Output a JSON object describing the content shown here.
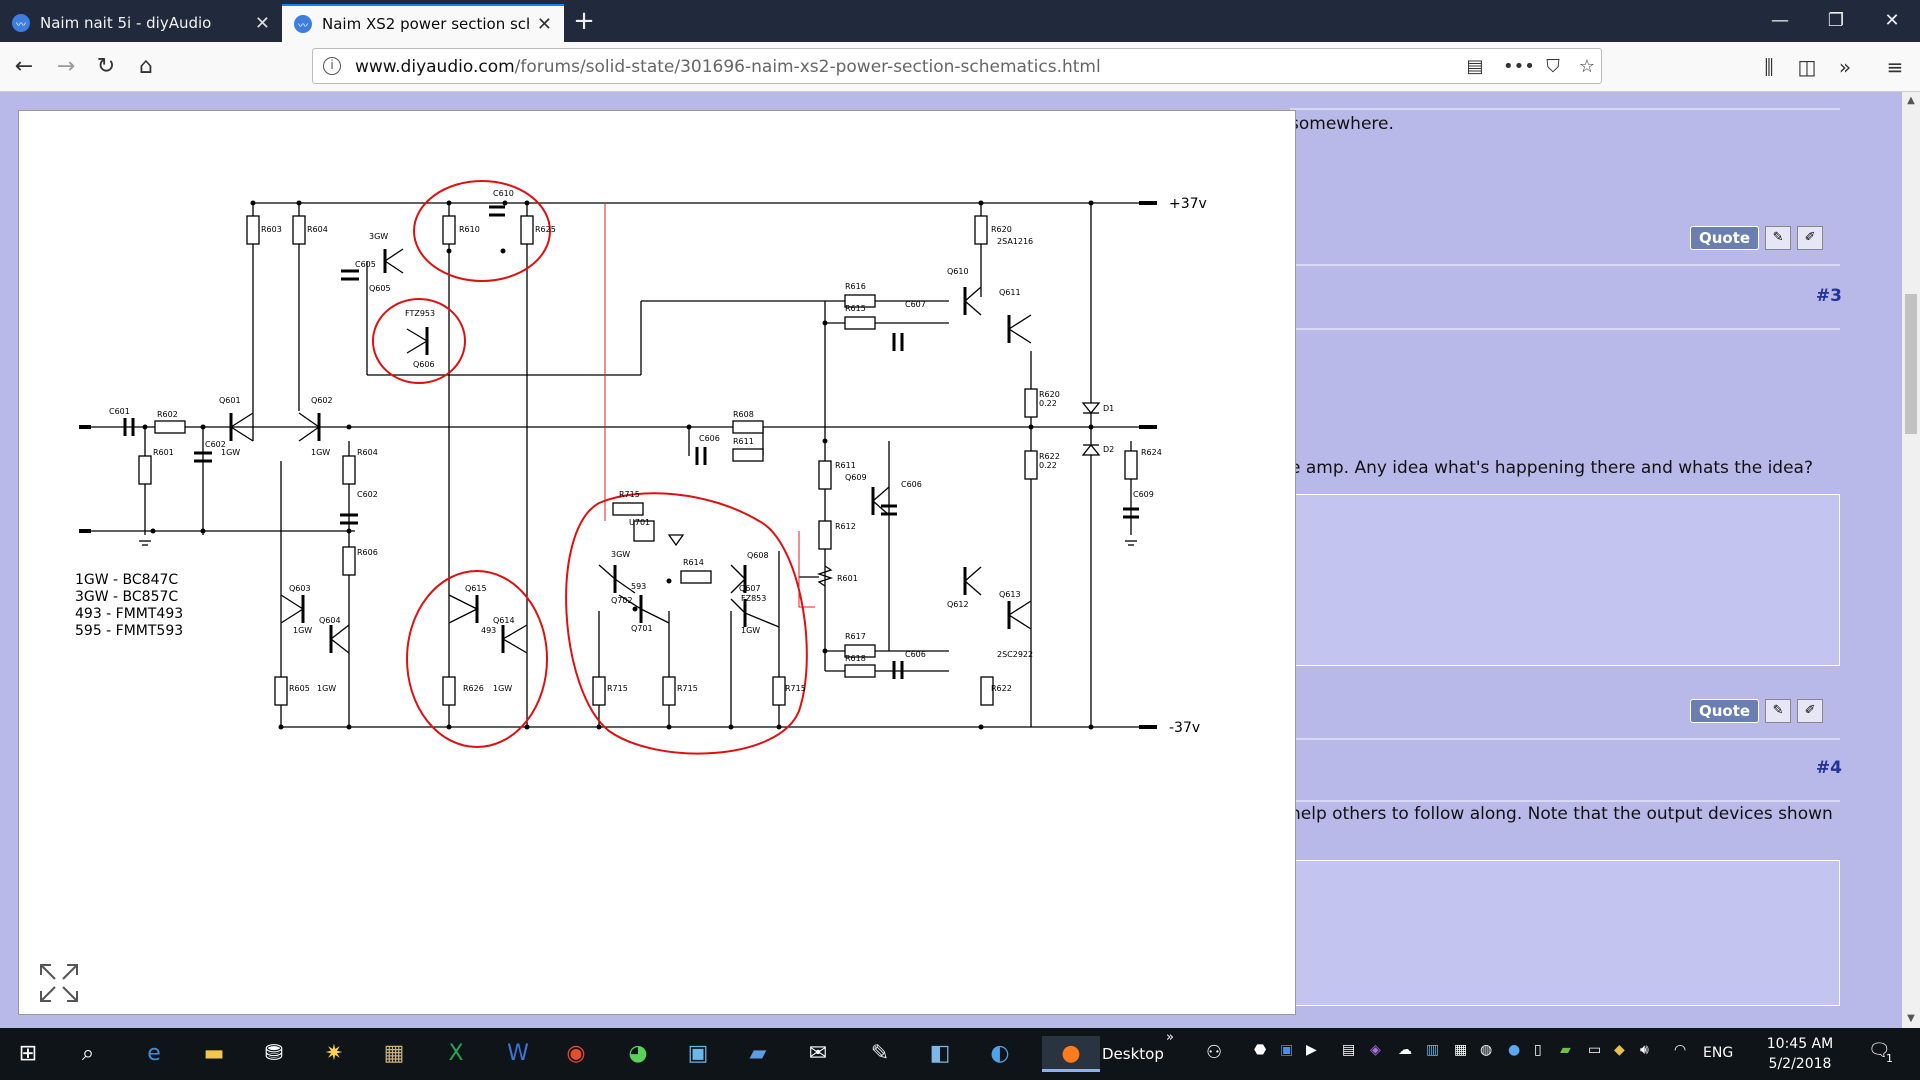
{
  "browser": {
    "tabs": [
      {
        "title": "Naim nait 5i - diyAudio",
        "active": false
      },
      {
        "title": "Naim XS2 power section schem",
        "active": true
      }
    ],
    "url_host": "www.diyaudio.com",
    "url_path": "/forums/solid-state/301696-naim-xs2-power-section-schematics.html"
  },
  "page": {
    "fragment_top": "somewhere.",
    "quote_label": "Quote",
    "post3_number": "#3",
    "post3_text": "e amp. Any idea what's happening there and whats the idea?",
    "post4_number": "#4",
    "post4_text": "help others to follow along. Note that the output devices shown"
  },
  "schematic": {
    "rail_pos": "+37v",
    "rail_neg": "-37v",
    "legend": [
      "1GW - BC847C",
      "3GW - BC857C",
      "493 - FMMT493",
      "595 - FMMT593"
    ],
    "labels": {
      "R603": "R603",
      "R604a": "R604",
      "R610": "R610",
      "C610": "C610",
      "R625": "R625",
      "g3GWa": "3GW",
      "C605": "C605",
      "Q605": "Q605",
      "FTZ953": "FTZ953",
      "Q606": "Q606",
      "R620": "R620",
      "SA1216": "2SA1216",
      "Q610": "Q610",
      "Q611": "Q611",
      "R616": "R616",
      "R615": "R615",
      "C607": "C607",
      "C601": "C601",
      "R602": "R602",
      "Q601": "Q601",
      "Q602": "Q602",
      "C602a": "C602",
      "g1GWa": "1GW",
      "g1GWb": "1GW",
      "R601a": "R601",
      "R604b": "R604",
      "R608": "R608",
      "C606a": "C606",
      "R611a": "R611",
      "R620b": "R620",
      "v022a": "0.22",
      "D1": "D1",
      "D2": "D2",
      "R622a": "R622",
      "v022b": "0.22",
      "R624": "R624",
      "R611b": "R611",
      "Q609": "Q609",
      "C606b": "C606",
      "C609": "C609",
      "C602b": "C602",
      "R715a": "R715",
      "U701": "U701",
      "R612": "R612",
      "R606": "R606",
      "g3GWb": "3GW",
      "R614": "R614",
      "Q608": "Q608",
      "R601b": "R601",
      "Q603": "Q603",
      "Q615": "Q615",
      "v593": "593",
      "Q702": "Q702",
      "Q607": "Q607",
      "FZ853": "FZ853",
      "Q613": "Q613",
      "Q612": "Q612",
      "Q604": "Q604",
      "Q614": "Q614",
      "v493": "493",
      "Q701": "Q701",
      "g1GWc": "1GW",
      "R617": "R617",
      "R618": "R618",
      "C606c": "C606",
      "SC2922": "2SC2922",
      "g1GWd": "1GW",
      "R605": "R605",
      "g1GWe": "1GW",
      "R626": "R626",
      "g1GWf": "1GW",
      "R715b": "R715",
      "R715c": "R715",
      "R715d": "R715",
      "R622b": "R622"
    }
  },
  "taskbar": {
    "desktop_label": "Desktop",
    "lang": "ENG",
    "time": "10:45 AM",
    "date": "5/2/2018",
    "notif_count": "1"
  }
}
